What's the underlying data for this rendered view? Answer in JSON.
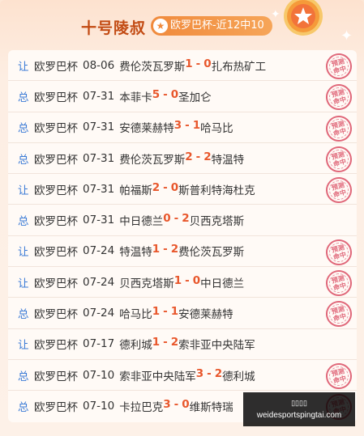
{
  "header": {
    "title": "十号陵叔",
    "badge": "欧罗巴杯-近12中10"
  },
  "stamp_text": [
    "预测",
    "命中"
  ],
  "rows": [
    {
      "kind": "让",
      "league": "欧罗巴杯",
      "date": "08-06",
      "home": "费伦茨瓦罗斯",
      "hs": "1",
      "as": "0",
      "away": "扎布热矿工",
      "hit": true
    },
    {
      "kind": "总",
      "league": "欧罗巴杯",
      "date": "07-31",
      "home": "本菲卡",
      "hs": "5",
      "as": "0",
      "away": "圣加仑",
      "hit": true
    },
    {
      "kind": "总",
      "league": "欧罗巴杯",
      "date": "07-31",
      "home": "安德莱赫特",
      "hs": "3",
      "as": "1",
      "away": "哈马比",
      "hit": true
    },
    {
      "kind": "总",
      "league": "欧罗巴杯",
      "date": "07-31",
      "home": "费伦茨瓦罗斯",
      "hs": "2",
      "as": "2",
      "away": "特温特",
      "hit": true
    },
    {
      "kind": "让",
      "league": "欧罗巴杯",
      "date": "07-31",
      "home": "帕福斯",
      "hs": "2",
      "as": "0",
      "away": "斯普利特海杜克",
      "hit": true
    },
    {
      "kind": "总",
      "league": "欧罗巴杯",
      "date": "07-31",
      "home": "中日德兰",
      "hs": "0",
      "as": "2",
      "away": "贝西克塔斯",
      "hit": false
    },
    {
      "kind": "让",
      "league": "欧罗巴杯",
      "date": "07-24",
      "home": "特温特",
      "hs": "1",
      "as": "2",
      "away": "费伦茨瓦罗斯",
      "hit": true
    },
    {
      "kind": "让",
      "league": "欧罗巴杯",
      "date": "07-24",
      "home": "贝西克塔斯",
      "hs": "1",
      "as": "0",
      "away": "中日德兰",
      "hit": true
    },
    {
      "kind": "总",
      "league": "欧罗巴杯",
      "date": "07-24",
      "home": "哈马比",
      "hs": "1",
      "as": "1",
      "away": "安德莱赫特",
      "hit": true
    },
    {
      "kind": "让",
      "league": "欧罗巴杯",
      "date": "07-17",
      "home": "德利城",
      "hs": "1",
      "as": "2",
      "away": "索非亚中央陆军",
      "hit": false
    },
    {
      "kind": "总",
      "league": "欧罗巴杯",
      "date": "07-10",
      "home": "索非亚中央陆军",
      "hs": "3",
      "as": "2",
      "away": "德利城",
      "hit": true
    },
    {
      "kind": "总",
      "league": "欧罗巴杯",
      "date": "07-10",
      "home": "卡拉巴克",
      "hs": "3",
      "as": "0",
      "away": "维斯特瑞",
      "hit": true
    }
  ],
  "overlay": {
    "line1": "▯▯▯▯",
    "line2": "weidesportspingtai.com"
  },
  "colors": {
    "title": "#c24a12",
    "badge": "#f08a3c",
    "score": "#e8572c",
    "kind": "#3b7bd6",
    "stamp": "#e0687a"
  }
}
